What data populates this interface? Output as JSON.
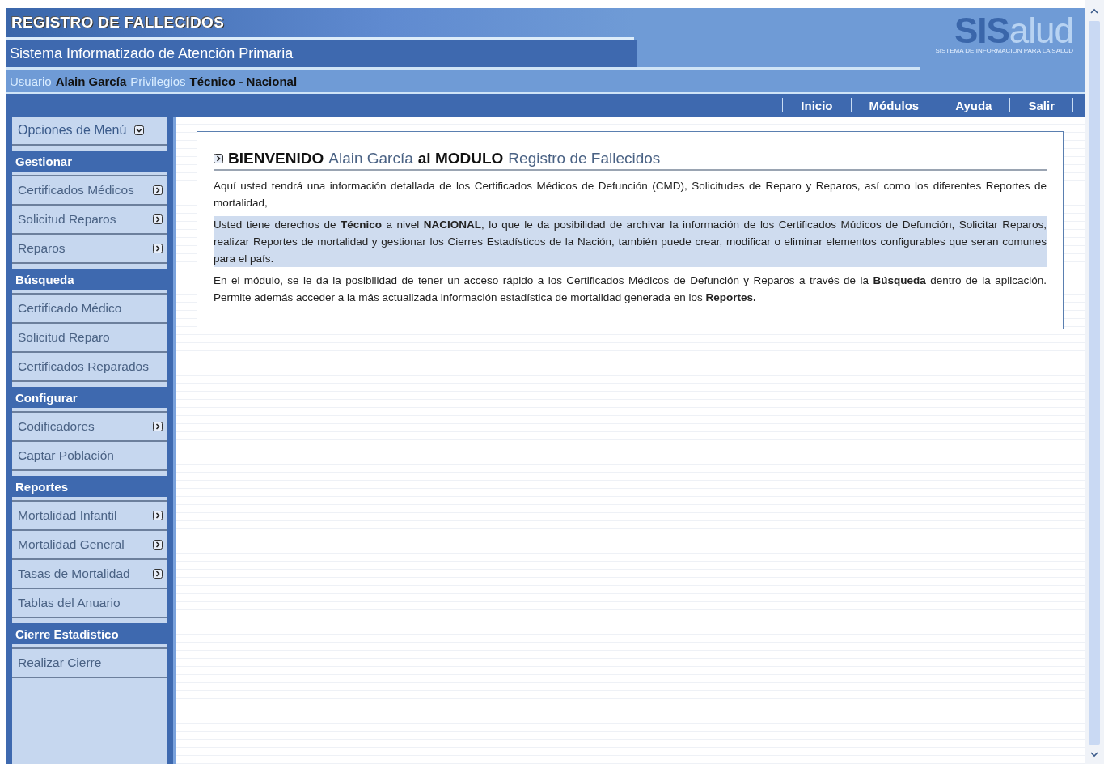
{
  "header": {
    "title": "REGISTRO DE FALLECIDOS",
    "subtitle": "Sistema Informatizado de Atención Primaria",
    "user_label": "Usuario",
    "user_name": "Alain García",
    "privileges_label": "Privilegios",
    "privileges_value": "Técnico - Nacional",
    "logo": {
      "strong": "SIS",
      "light": "alud",
      "tagline": "SISTEMA DE INFORMACION PARA LA SALUD"
    }
  },
  "nav": [
    {
      "label": "Inicio"
    },
    {
      "label": "Módulos"
    },
    {
      "label": "Ayuda"
    },
    {
      "label": "Salir"
    }
  ],
  "sidebar": {
    "menu_title": "Opciones de Menú",
    "sections": [
      {
        "title": "Gestionar",
        "items": [
          {
            "label": "Certificados Médicos",
            "submenu": true
          },
          {
            "label": "Solicitud Reparos",
            "submenu": true
          },
          {
            "label": "Reparos",
            "submenu": true
          }
        ]
      },
      {
        "title": "Búsqueda",
        "items": [
          {
            "label": "Certificado Médico",
            "submenu": false
          },
          {
            "label": "Solicitud Reparo",
            "submenu": false
          },
          {
            "label": "Certificados Reparados",
            "submenu": false
          }
        ]
      },
      {
        "title": "Configurar",
        "items": [
          {
            "label": "Codificadores",
            "submenu": true
          },
          {
            "label": "Captar Población",
            "submenu": false
          }
        ]
      },
      {
        "title": "Reportes",
        "items": [
          {
            "label": "Mortalidad Infantil",
            "submenu": true
          },
          {
            "label": "Mortalidad General",
            "submenu": true
          },
          {
            "label": "Tasas de Mortalidad",
            "submenu": true
          },
          {
            "label": "Tablas del Anuario",
            "submenu": false
          }
        ]
      },
      {
        "title": "Cierre Estadístico",
        "items": [
          {
            "label": "Realizar Cierre",
            "submenu": false
          }
        ]
      }
    ]
  },
  "welcome": {
    "heading": [
      {
        "text": "BIENVENIDO",
        "emphasis": true
      },
      {
        "text": "Alain García",
        "emphasis": false
      },
      {
        "text": "al MODULO",
        "emphasis": true
      },
      {
        "text": "Registro de Fallecidos",
        "emphasis": false
      }
    ],
    "paragraphs": [
      {
        "text": "Aquí usted tendrá una información detallada de los Certificados Médicos de Defunción (CMD), Solicitudes de Reparo y Reparos, así como los diferentes Reportes de mortalidad,",
        "highlighted": false
      },
      {
        "text": "Usted tiene derechos de **Técnico** a nivel **NACIONAL**, lo que le da posibilidad de archivar la información de los Certificados Múdicos de Defunción, Solicitar Reparos, realizar Reportes de mortalidad y gestionar los Cierres Estadísticos de la Nación, también puede crear, modificar o eliminar elementos configurables que seran comunes para el país.",
        "highlighted": true
      },
      {
        "text": "En el módulo, se le da la posibilidad de tener un acceso rápido a los Certificados Médicos de Defunción y Reparos a través de la **Búsqueda** dentro de la aplicación. Permite además acceder a la más actualizada información estadística de mortalidad generada en los **Reportes.**",
        "highlighted": false
      }
    ]
  }
}
